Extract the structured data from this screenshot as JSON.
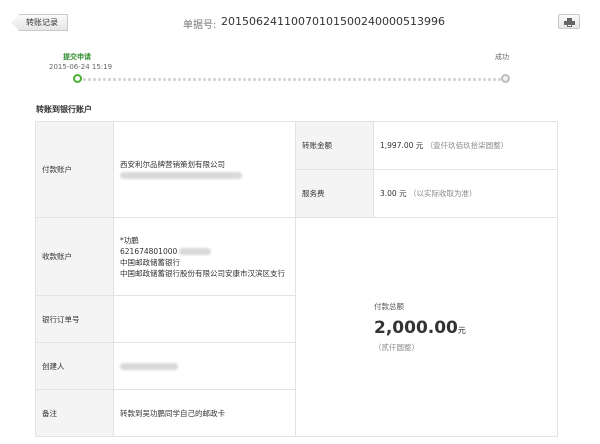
{
  "header": {
    "back_label": "转账记录",
    "order_label": "单据号:",
    "order_number": "20150624110070101500240000513996"
  },
  "progress": {
    "start_label": "提交申请",
    "start_time": "2015-06-24 15:19",
    "end_label": "成功"
  },
  "section": {
    "title": "转账到银行账户"
  },
  "details": {
    "payer_label": "付款账户",
    "payer_company": "西安利尔品牌营销策划有限公司",
    "payee_label": "收款账户",
    "payee_name": "*功鹏",
    "payee_account": "621674801000",
    "payee_bank": "中国邮政储蓄银行",
    "payee_branch": "中国邮政储蓄银行股份有限公司安康市汉滨区支行",
    "bank_order_label": "银行订单号",
    "bank_order_value": "",
    "creator_label": "创建人",
    "remark_label": "备注",
    "remark_value": "转款到吴功鹏同学自己的邮政卡",
    "amount_label": "转账金额",
    "amount_value": "1,997.00 元",
    "amount_words": "（壹仟玖佰玖拾柒圆整）",
    "fee_label": "服务费",
    "fee_value": "3.00 元",
    "fee_note": "（以实际收取为准）",
    "total_label": "付款总额",
    "total_value": "2,000.00",
    "total_unit": "元",
    "total_words": "（贰仟圆整）"
  }
}
